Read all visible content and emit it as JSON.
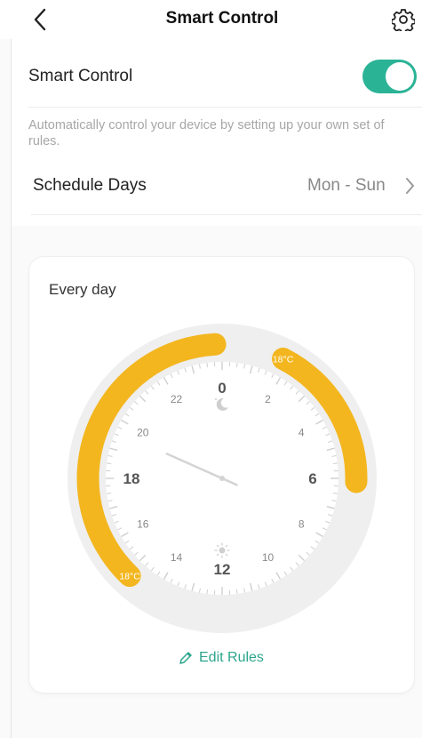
{
  "header": {
    "title": "Smart Control",
    "back_icon": "chevron-left-icon",
    "settings_icon": "gear-icon"
  },
  "smart_control": {
    "label": "Smart Control",
    "enabled": true,
    "description": "Automatically control your device by setting up your own set of rules."
  },
  "schedule": {
    "label": "Schedule Days",
    "value": "Mon - Sun"
  },
  "clock": {
    "title": "Every day",
    "major_labels": [
      "0",
      "6",
      "12",
      "18"
    ],
    "minor_labels": [
      "2",
      "4",
      "8",
      "10",
      "14",
      "16",
      "20",
      "22"
    ],
    "rules": [
      {
        "start_hour": 1.8,
        "end_hour": 6.1,
        "temp_label": "18°C"
      },
      {
        "start_hour": 14.9,
        "end_hour": 23.8,
        "temp_label": "18°C"
      }
    ],
    "hand_hour": 19.6,
    "accent_color": "#f3b61f",
    "edit_label": "Edit Rules"
  },
  "colors": {
    "brand": "#2bb396",
    "arc": "#f3b61f",
    "link": "#2ca58d"
  }
}
